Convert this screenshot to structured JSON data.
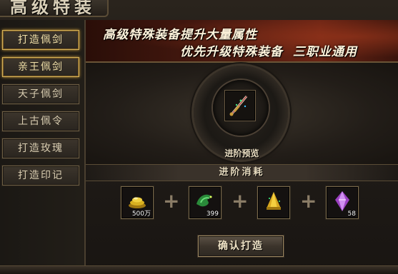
{
  "window": {
    "title": "高级特装"
  },
  "sidebar": {
    "items": [
      {
        "label": "打造佩剑",
        "active": true
      },
      {
        "label": "亲王佩剑",
        "active": true
      },
      {
        "label": "天子佩剑",
        "active": false
      },
      {
        "label": "上古佩令",
        "active": false
      },
      {
        "label": "打造玫瑰",
        "active": false
      },
      {
        "label": "打造印记",
        "active": false
      }
    ]
  },
  "banner": {
    "line1": "高级特殊装备提升大量属性",
    "line2": "优先升级特殊装备  三职业通用"
  },
  "preview": {
    "label": "进阶预览",
    "item_icon": "sword-icon"
  },
  "cost": {
    "title": "进阶消耗",
    "items": [
      {
        "icon": "gold-pile-icon",
        "qty": "500万"
      },
      {
        "icon": "green-dragon-icon",
        "qty": "399"
      },
      {
        "icon": "gold-ingot-icon",
        "qty": ""
      },
      {
        "icon": "purple-gem-icon",
        "qty": "58"
      }
    ]
  },
  "actions": {
    "confirm_label": "确认打造"
  },
  "colors": {
    "accent_gold": "#d4b25a",
    "banner_red": "#6a2414",
    "text_light": "#e8dcc0"
  }
}
